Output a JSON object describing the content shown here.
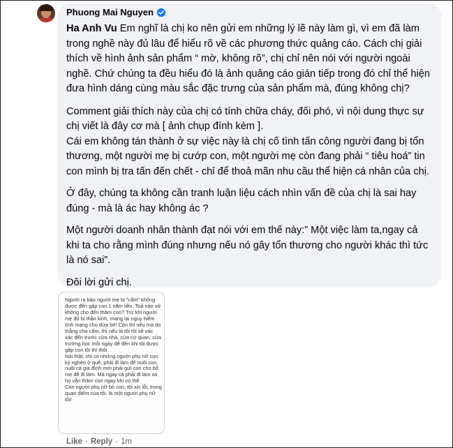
{
  "comment": {
    "author": "Phuong Mai Nguyen",
    "mention": "Ha Anh Vu",
    "paragraphs": [
      " Em nghĩ là chị ko nên gửi em những lý lẽ này làm gì, vì em đã làm trong nghề này đủ lâu để hiểu rõ về các phương thức quảng cáo. Cách chị giải thích về hình ảnh sản phẩm “ mờ, không rõ”, chị chỉ nên nói với người ngoài nghề. Chứ chúng ta đều hiểu đó là ảnh quảng cáo gián tiếp trong đó chỉ thể hiện đưa hình dáng cùng màu sắc đặc trưng của sản phẩm mà, đúng không chị?",
      "Comment giải thích này của chị có tính chữa cháy, đối phó, vì nội dung thực sự chị viết là đây cơ mà [ ảnh chụp đính kèm ].",
      "Cái em không tán thành ở sự việc này là chị cố tình tấn công người đang bị tổn thương, một người mẹ bị cướp con, một người mẹ còn đang phải “ tiêu hoá” tin con mình bị tra tấn đến chết - chỉ để thoả mãn nhu cầu thể hiện cá nhân của chị.",
      "Ở đây, chúng ta không cần tranh luận liệu cách nhìn vấn đề của chị là sai hay đúng - mà là ác hay không ác ?",
      "Một người doanh nhân thành đạt nói với em thế này:” Một việc làm ta,ngay cả khi ta cho rằng mình đúng nhưng nếu nó gây tổn thương cho người khác thì tức là nó sai”.",
      "Đôi lời gửi chị."
    ],
    "attachment_text": "Người ra bảo người mẹ bị \"cấm\" không được đến gặp con 1 năm liền. Toà nào xử không cho đến thăm con? Trừ khi người mẹ đó bị thần kinh, mang lại nguy hiểm tính mạng cho đứa bé! Còn thì nếu mà do thằng cha cấm, thì nếu là tôi tôi sẽ vác xác đến trước cửa nhà, cửa cơ quan, cửa trường học mỗi ngày để đến khi tôi được gặp con tôi thì thôi.\nNói thật, chỉ có những người phụ nữ cực kỳ nghèo ở quê, phải đi làm để nuôi con, nuôi cả gia đình mới phải gửi con cho bố mẹ để đi làm. Mà ngay cả phải đi làm xa họ vẫn thăm con ngay khi có thể.\nCòn người phụ nữ bỏ con, tôi xin lỗi, trong quan điểm của tôi, là một người phụ nữ tồi!",
    "actions": {
      "like": "Like",
      "reply": "Reply",
      "separator": "·",
      "time": "1m"
    }
  },
  "colors": {
    "bubble": "#f0f2f5",
    "verified": "#1877f2",
    "meta": "#65676b"
  }
}
